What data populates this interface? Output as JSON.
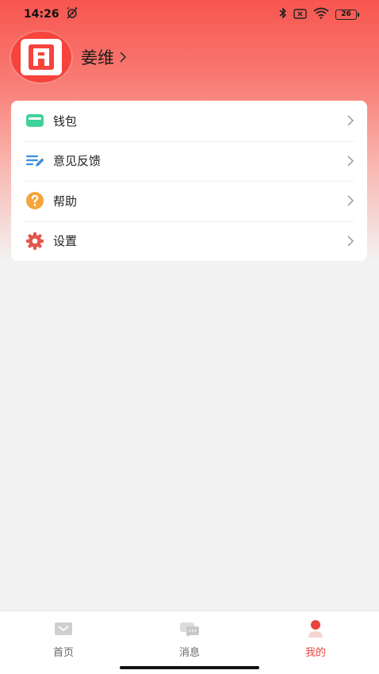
{
  "status_bar": {
    "time": "14:26",
    "battery_level": "26",
    "icons": [
      "alarm-off-icon",
      "bluetooth-icon",
      "sim-off-icon",
      "wifi-icon",
      "battery-icon"
    ]
  },
  "profile": {
    "username": "姜维",
    "avatar_icon": "app-logo-icon"
  },
  "menu": {
    "items": [
      {
        "label": "钱包",
        "icon": "wallet-icon",
        "color": "#3fd29a"
      },
      {
        "label": "意见反馈",
        "icon": "feedback-edit-icon",
        "color": "#3f8fd9"
      },
      {
        "label": "帮助",
        "icon": "help-icon",
        "color": "#f4a53b"
      },
      {
        "label": "设置",
        "icon": "settings-gear-icon",
        "color": "#e2574c"
      }
    ]
  },
  "tabs": [
    {
      "label": "首页",
      "icon": "home-icon",
      "active": false
    },
    {
      "label": "消息",
      "icon": "messages-icon",
      "active": false
    },
    {
      "label": "我的",
      "icon": "profile-icon",
      "active": true
    }
  ],
  "colors": {
    "accent": "#e8443e",
    "header_top": "#f7564f",
    "background": "#f2f2f2"
  }
}
